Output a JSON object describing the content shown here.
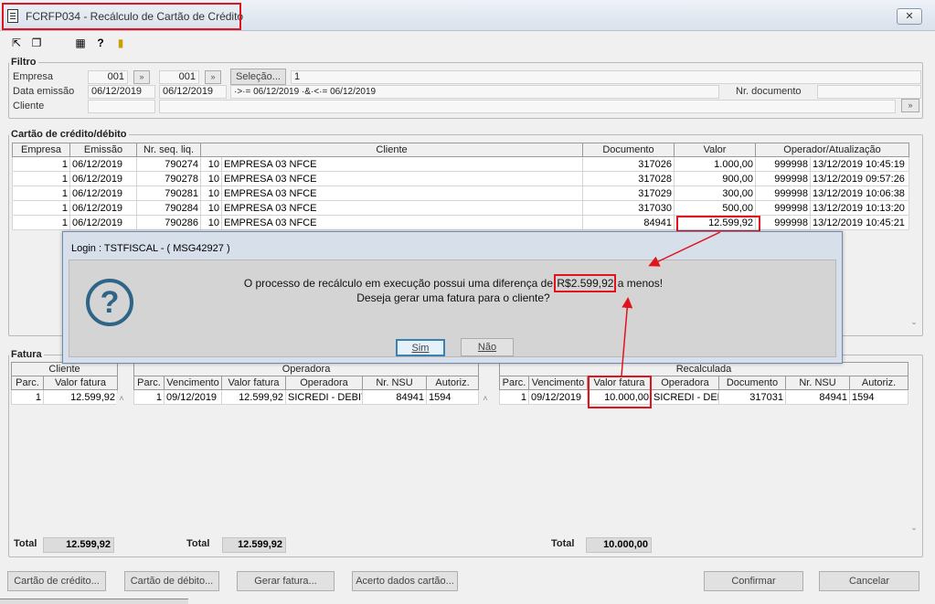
{
  "window": {
    "title": "FCRFP034 - Recálculo de Cartão de Crédito",
    "close": "✕"
  },
  "filtro": {
    "legend": "Filtro",
    "empresa_label": "Empresa",
    "empresa_from": "001",
    "empresa_to": "001",
    "selecao_label": "Seleção...",
    "selecao_value": "1",
    "data_label": "Data emissão",
    "data_from": "06/12/2019",
    "data_to": "06/12/2019",
    "data_expr": "·>·= 06/12/2019 ·&·<·= 06/12/2019",
    "nr_documento_label": "Nr. documento",
    "cliente_label": "Cliente"
  },
  "cartao": {
    "legend": "Cartão de crédito/débito",
    "columns": [
      "Empresa",
      "Emissão",
      "Nr. seq. liq.",
      "Cliente",
      "Documento",
      "Valor",
      "Operador/Atualização"
    ],
    "rows": [
      {
        "empresa": "1",
        "emissao": "06/12/2019",
        "seq": "790274",
        "cli_cod": "10",
        "cli_nome": "EMPRESA 03 NFCE",
        "documento": "317026",
        "valor": "1.000,00",
        "operador": "999998",
        "atualizacao": "13/12/2019 10:45:19"
      },
      {
        "empresa": "1",
        "emissao": "06/12/2019",
        "seq": "790278",
        "cli_cod": "10",
        "cli_nome": "EMPRESA 03 NFCE",
        "documento": "317028",
        "valor": "900,00",
        "operador": "999998",
        "atualizacao": "13/12/2019 09:57:26"
      },
      {
        "empresa": "1",
        "emissao": "06/12/2019",
        "seq": "790281",
        "cli_cod": "10",
        "cli_nome": "EMPRESA 03 NFCE",
        "documento": "317029",
        "valor": "300,00",
        "operador": "999998",
        "atualizacao": "13/12/2019 10:06:38"
      },
      {
        "empresa": "1",
        "emissao": "06/12/2019",
        "seq": "790284",
        "cli_cod": "10",
        "cli_nome": "EMPRESA 03 NFCE",
        "documento": "317030",
        "valor": "500,00",
        "operador": "999998",
        "atualizacao": "13/12/2019 10:13:20"
      },
      {
        "empresa": "1",
        "emissao": "06/12/2019",
        "seq": "790286",
        "cli_cod": "10",
        "cli_nome": "EMPRESA 03 NFCE",
        "documento": "84941",
        "valor": "12.599,92",
        "operador": "999998",
        "atualizacao": "13/12/2019 10:45:21"
      }
    ]
  },
  "fatura": {
    "legend": "Fatura",
    "cliente": {
      "group": "Cliente",
      "columns": [
        "Parc.",
        "Valor fatura"
      ],
      "row": {
        "parc": "1",
        "valor": "12.599,92"
      },
      "total_label": "Total",
      "total": "12.599,92"
    },
    "operadora": {
      "group": "Operadora",
      "columns": [
        "Parc.",
        "Vencimento",
        "Valor fatura",
        "Operadora",
        "Nr. NSU",
        "Autoriz."
      ],
      "row": {
        "parc": "1",
        "vencimento": "09/12/2019",
        "valor": "12.599,92",
        "operadora": "SICREDI - DEBITO",
        "nsu": "84941",
        "autoriz": "1594"
      },
      "total_label": "Total",
      "total": "12.599,92"
    },
    "recalculada": {
      "group": "Recalculada",
      "columns": [
        "Parc.",
        "Vencimento",
        "Valor fatura",
        "Operadora",
        "Documento",
        "Nr. NSU",
        "Autoriz."
      ],
      "row": {
        "parc": "1",
        "vencimento": "09/12/2019",
        "valor": "10.000,00",
        "operadora": "SICREDI - DEBITO",
        "documento": "317031",
        "nsu": "84941",
        "autoriz": "1594"
      },
      "total_label": "Total",
      "total": "10.000,00"
    }
  },
  "buttons": {
    "cartao_credito": "Cartão de crédito...",
    "cartao_debito": "Cartão de débito...",
    "gerar_fatura": "Gerar fatura...",
    "acerto": "Acerto dados cartão...",
    "confirmar": "Confirmar",
    "cancelar": "Cancelar"
  },
  "dialog": {
    "title": "Login : TSTFISCAL - ( MSG42927 )",
    "msg_pre": "O processo de recálculo em execução possui uma diferença de ",
    "msg_amount": "R$2.599,92",
    "msg_post": " a menos!",
    "msg_line2": "Deseja gerar uma fatura para o cliente?",
    "yes": "Sim",
    "no": "Não",
    "icon": "question-icon"
  },
  "colors": {
    "highlight": "#e0141e",
    "dialog_icon": "#2e6486"
  }
}
